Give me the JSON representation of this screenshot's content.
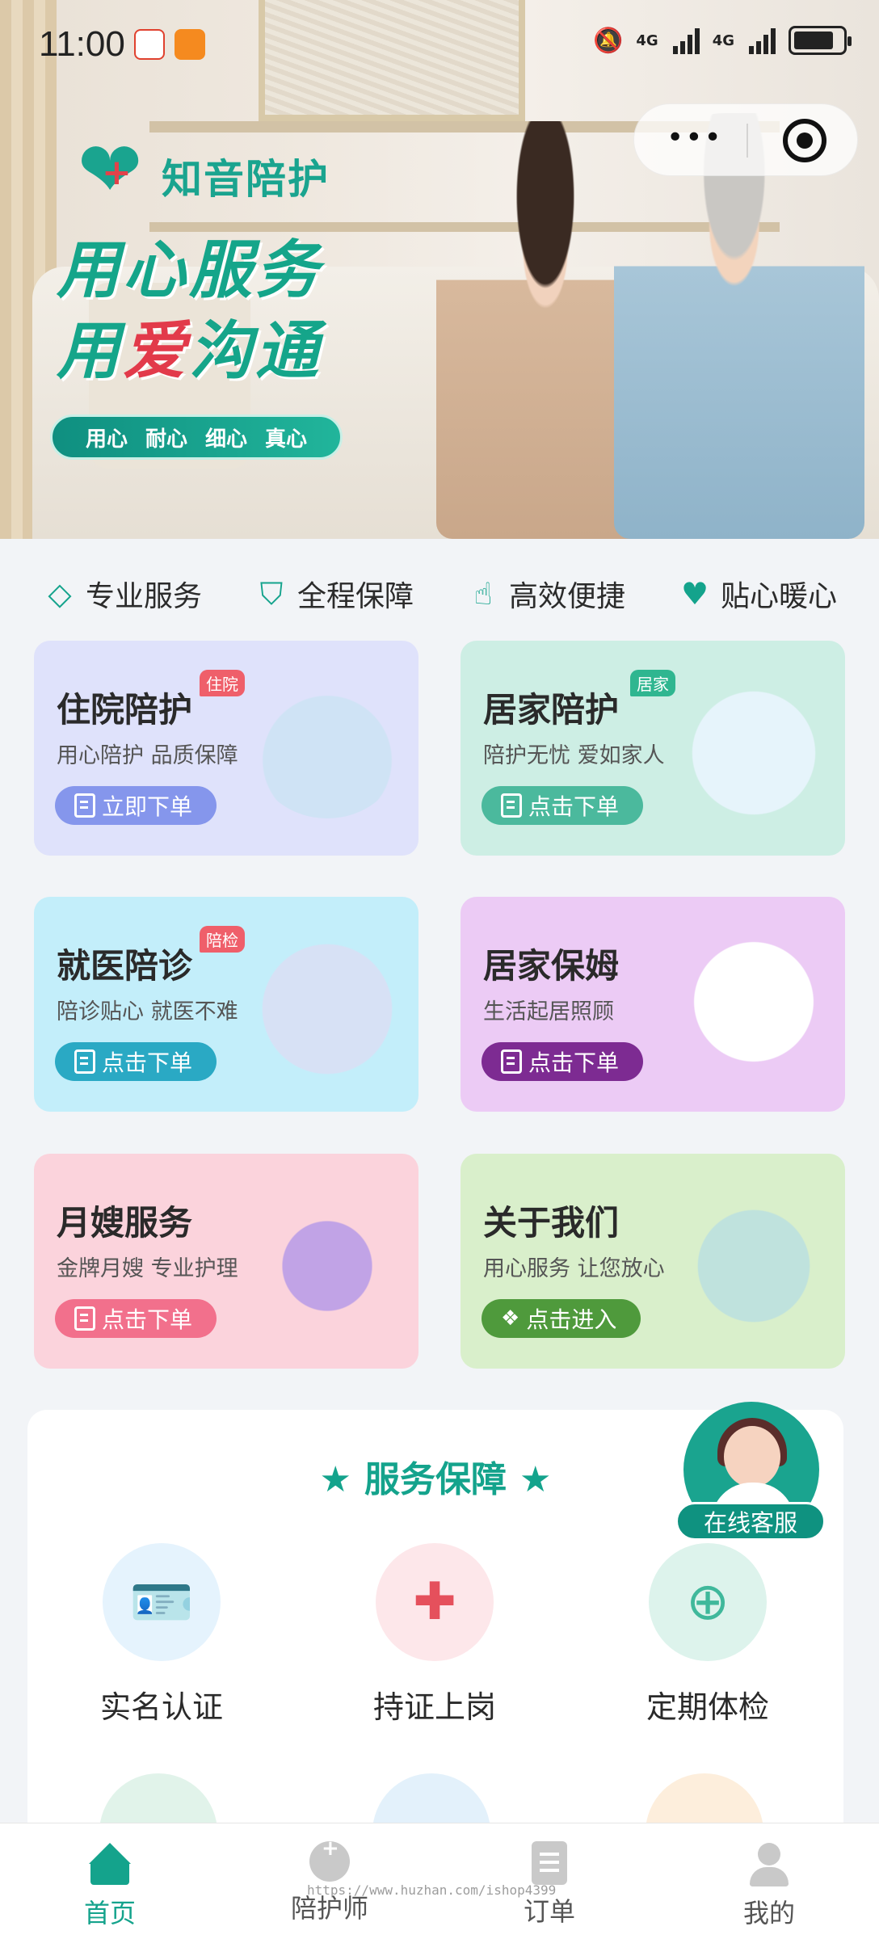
{
  "status_bar": {
    "time": "11:00",
    "network1": "4G",
    "network2": "4G"
  },
  "hero": {
    "brand": "知音陪护",
    "slogan_line1": "用心服务",
    "slogan_line2_prefix": "用",
    "slogan_line2_highlight": "爱",
    "slogan_line2_suffix": "沟通",
    "virtues": [
      "用心",
      "耐心",
      "细心",
      "真心"
    ]
  },
  "features": [
    {
      "label": "专业服务",
      "icon": "diamond-icon"
    },
    {
      "label": "全程保障",
      "icon": "shield-icon"
    },
    {
      "label": "高效便捷",
      "icon": "touch-icon"
    },
    {
      "label": "贴心暖心",
      "icon": "heart-icon"
    }
  ],
  "cards": {
    "inpatient": {
      "title": "住院陪护",
      "badge": "住院",
      "subtitle": "用心陪护 品质保障",
      "button": "立即下单"
    },
    "home": {
      "title": "居家陪护",
      "badge": "居家",
      "subtitle": "陪护无忧 爱如家人",
      "button": "点击下单"
    },
    "escort": {
      "title": "就医陪诊",
      "badge": "陪检",
      "subtitle": "陪诊贴心 就医不难",
      "button": "点击下单"
    },
    "nanny": {
      "title": "居家保姆",
      "subtitle": "生活起居照顾",
      "button": "点击下单"
    },
    "maternity": {
      "title": "月嫂服务",
      "subtitle": "金牌月嫂 专业护理",
      "button": "点击下单"
    },
    "about": {
      "title": "关于我们",
      "subtitle": "用心服务 让您放心",
      "button": "点击进入"
    }
  },
  "guarantee": {
    "title": "服务保障",
    "items": [
      {
        "label": "实名认证",
        "icon": "id-card-icon"
      },
      {
        "label": "持证上岗",
        "icon": "nurse-cap-icon"
      },
      {
        "label": "定期体检",
        "icon": "medical-kit-icon"
      }
    ]
  },
  "customer_service": {
    "label": "在线客服"
  },
  "tabbar": [
    {
      "label": "首页",
      "icon": "home-icon",
      "active": true
    },
    {
      "label": "陪护师",
      "icon": "nurse-icon",
      "active": false
    },
    {
      "label": "订单",
      "icon": "order-icon",
      "active": false
    },
    {
      "label": "我的",
      "icon": "profile-icon",
      "active": false
    }
  ],
  "watermark": "https://www.huzhan.com/ishop4399",
  "colors": {
    "accent": "#14a38c",
    "love_red": "#e23a4a",
    "background": "#f2f4f7"
  }
}
